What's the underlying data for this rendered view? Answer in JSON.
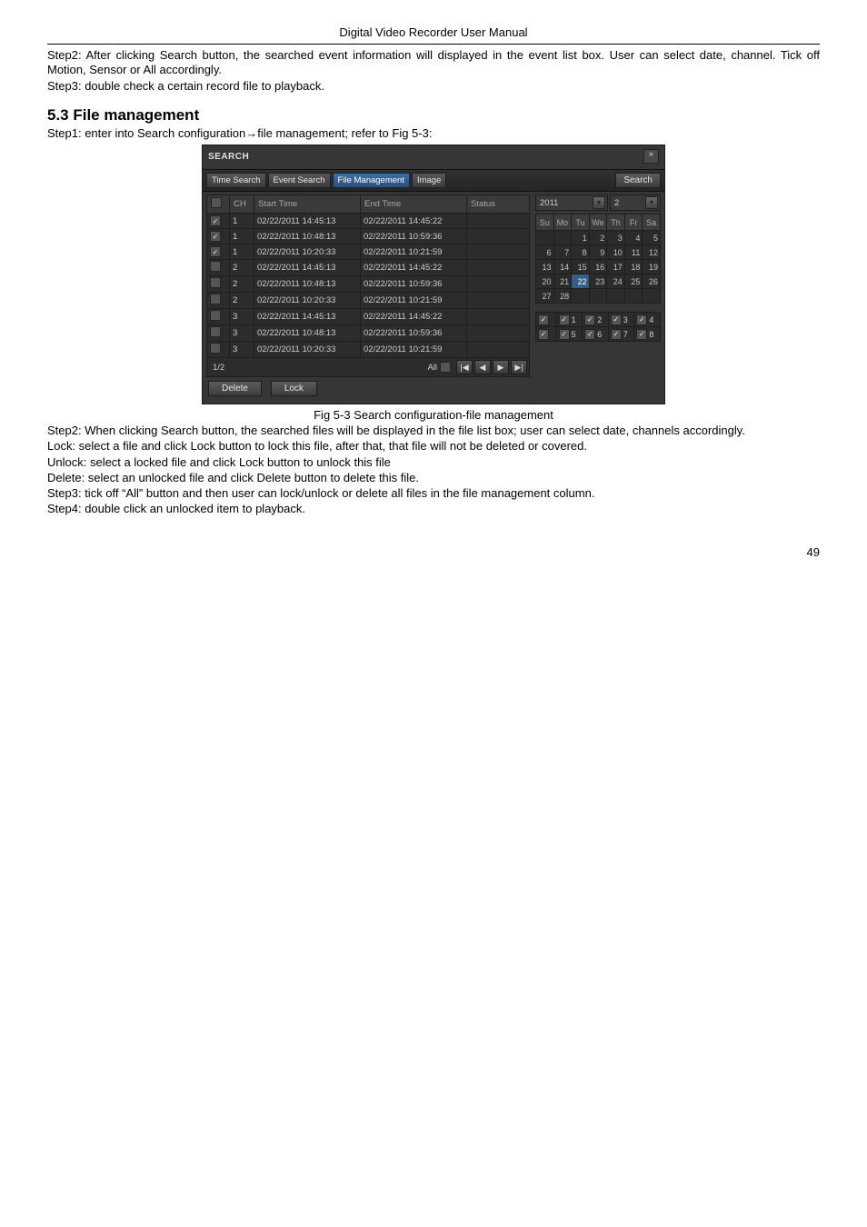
{
  "header": "Digital Video Recorder User Manual",
  "para": {
    "step2_top": "Step2: After clicking Search button, the searched event information will displayed in the event list box. User can select date, channel. Tick off Motion, Sensor or All accordingly.",
    "step3_top": "Step3: double check a certain record file to playback.",
    "section": "5.3  File management",
    "step1": "Step1: enter into Search configuration→file management; refer to Fig 5-3:",
    "caption": "Fig 5-3 Search configuration-file management",
    "step2_bot": "Step2: When clicking Search button, the searched files will be displayed in the file list box; user can select date, channels accordingly.",
    "lock": "Lock: select a file and click Lock button to lock this file, after that, that file will not be deleted or covered.",
    "unlock": "Unlock: select a locked file and click Lock button to unlock this file",
    "delete": "Delete: select an unlocked file and click Delete button to delete this file.",
    "step3_bot": "Step3: tick off “All” button and then user can lock/unlock or delete all files in the file management column.",
    "step4": "Step4: double click an unlocked item to playback."
  },
  "dvr": {
    "title": "SEARCH",
    "close": "×",
    "tabs": [
      "Time Search",
      "Event Search",
      "File Management",
      "Image"
    ],
    "active_tab": 2,
    "search_btn": "Search",
    "headers": {
      "chk": "",
      "ch": "CH",
      "start": "Start Time",
      "end": "End Time",
      "status": "Status"
    },
    "rows": [
      {
        "checked": true,
        "ch": "1",
        "start": "02/22/2011 14:45:13",
        "end": "02/22/2011 14:45:22",
        "status": ""
      },
      {
        "checked": true,
        "ch": "1",
        "start": "02/22/2011 10:48:13",
        "end": "02/22/2011 10:59:36",
        "status": ""
      },
      {
        "checked": true,
        "ch": "1",
        "start": "02/22/2011 10:20:33",
        "end": "02/22/2011 10:21:59",
        "status": ""
      },
      {
        "checked": false,
        "ch": "2",
        "start": "02/22/2011 14:45:13",
        "end": "02/22/2011 14:45:22",
        "status": ""
      },
      {
        "checked": false,
        "ch": "2",
        "start": "02/22/2011 10:48:13",
        "end": "02/22/2011 10:59:36",
        "status": ""
      },
      {
        "checked": false,
        "ch": "2",
        "start": "02/22/2011 10:20:33",
        "end": "02/22/2011 10:21:59",
        "status": ""
      },
      {
        "checked": false,
        "ch": "3",
        "start": "02/22/2011 14:45:13",
        "end": "02/22/2011 14:45:22",
        "status": ""
      },
      {
        "checked": false,
        "ch": "3",
        "start": "02/22/2011 10:48:13",
        "end": "02/22/2011 10:59:36",
        "status": ""
      },
      {
        "checked": false,
        "ch": "3",
        "start": "02/22/2011 10:20:33",
        "end": "02/22/2011 10:21:59",
        "status": ""
      }
    ],
    "pager": {
      "label": "1/2",
      "all": "All",
      "first": "|◀",
      "prev": "◀",
      "next": "▶",
      "last": "▶|"
    },
    "buttons": {
      "delete": "Delete",
      "lock": "Lock"
    },
    "year": "2011",
    "month": "2",
    "dow": [
      "Su",
      "Mo",
      "Tu",
      "We",
      "Th",
      "Fr",
      "Sa"
    ],
    "cal": [
      [
        "",
        "",
        "1",
        "2",
        "3",
        "4",
        "5"
      ],
      [
        "6",
        "7",
        "8",
        "9",
        "10",
        "11",
        "12"
      ],
      [
        "13",
        "14",
        "15",
        "16",
        "17",
        "18",
        "19"
      ],
      [
        "20",
        "21",
        "22",
        "23",
        "24",
        "25",
        "26"
      ],
      [
        "27",
        "28",
        "",
        "",
        "",
        "",
        ""
      ]
    ],
    "cal_selected": "22",
    "ch_grid": [
      [
        {
          "checked": true,
          "label": ""
        },
        {
          "checked": true,
          "label": "1"
        },
        {
          "checked": true,
          "label": "2"
        },
        {
          "checked": true,
          "label": "3"
        },
        {
          "checked": true,
          "label": "4"
        }
      ],
      [
        {
          "checked": true,
          "label": ""
        },
        {
          "checked": true,
          "label": "5"
        },
        {
          "checked": true,
          "label": "6"
        },
        {
          "checked": true,
          "label": "7"
        },
        {
          "checked": true,
          "label": "8"
        }
      ]
    ]
  },
  "page_number": "49"
}
